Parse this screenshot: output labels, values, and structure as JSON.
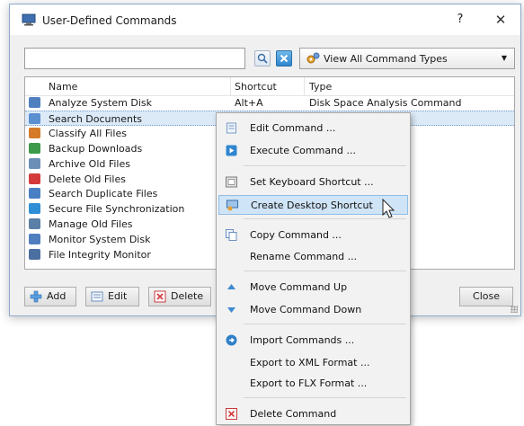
{
  "window": {
    "title": "User-Defined Commands",
    "help_label": "?",
    "close_label": "✕"
  },
  "search": {
    "value": "",
    "placeholder": ""
  },
  "filter": {
    "selected": "View All Command Types"
  },
  "list": {
    "columns": [
      "Name",
      "Shortcut",
      "Type"
    ],
    "rows": [
      {
        "name": "Analyze System Disk",
        "shortcut": "Alt+A",
        "type": "Disk Space Analysis Command",
        "icon_color": "#4f7fbf"
      },
      {
        "name": "Search Documents",
        "shortcut": "",
        "type": "d",
        "icon_color": "#5a8fd0"
      },
      {
        "name": "Classify All Files",
        "shortcut": "",
        "type": "mmand",
        "icon_color": "#d47b2a"
      },
      {
        "name": "Backup Downloads",
        "shortcut": "",
        "type": "Command",
        "icon_color": "#3c9a4a"
      },
      {
        "name": "Archive Old Files",
        "shortcut": "",
        "type": "",
        "icon_color": "#6c8fb8"
      },
      {
        "name": "Delete Old Files",
        "shortcut": "",
        "type": "d",
        "icon_color": "#d43a3a"
      },
      {
        "name": "Search Duplicate Files",
        "shortcut": "",
        "type": "n Command",
        "icon_color": "#4a7fc4"
      },
      {
        "name": "Secure File Synchronization",
        "shortcut": "",
        "type": "mand",
        "icon_color": "#2f8fd6"
      },
      {
        "name": "Manage Old Files",
        "shortcut": "",
        "type": "mand",
        "icon_color": "#5b7fa6"
      },
      {
        "name": "Monitor System Disk",
        "shortcut": "",
        "type": "mand",
        "icon_color": "#4f7fbf"
      },
      {
        "name": "File Integrity Monitor",
        "shortcut": "",
        "type": "ing Command",
        "icon_color": "#4a6fa0"
      }
    ],
    "selected_index": 1
  },
  "buttons": {
    "add": "Add",
    "edit": "Edit",
    "delete": "Delete",
    "close": "Close"
  },
  "menu": {
    "items": [
      {
        "label": "Edit Command ...",
        "icon": "edit-icon"
      },
      {
        "label": "Execute Command ...",
        "icon": "play-icon"
      },
      {
        "label": "Set Keyboard Shortcut ...",
        "icon": "keyboard-icon"
      },
      {
        "label": "Create Desktop Shortcut",
        "icon": "desktop-shortcut-icon"
      },
      {
        "label": "Copy Command ...",
        "icon": "copy-icon"
      },
      {
        "label": "Rename Command ...",
        "icon": ""
      },
      {
        "label": "Move Command Up",
        "icon": "arrow-up-icon"
      },
      {
        "label": "Move Command Down",
        "icon": "arrow-down-icon"
      },
      {
        "label": "Import Commands ...",
        "icon": "import-icon"
      },
      {
        "label": "Export to XML Format ...",
        "icon": ""
      },
      {
        "label": "Export to FLX Format ...",
        "icon": ""
      },
      {
        "label": "Delete Command",
        "icon": "delete-icon"
      }
    ],
    "highlighted_index": 3
  },
  "colors": {
    "accent": "#2f86cf",
    "selection": "#dceaf8",
    "menu_highlight": "#cfe4f7"
  }
}
